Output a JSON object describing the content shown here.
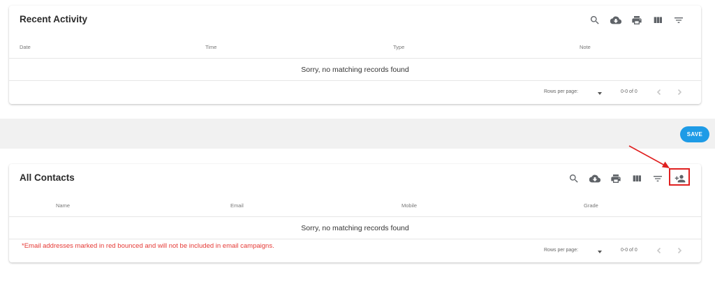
{
  "recent_activity": {
    "title": "Recent Activity",
    "toolbar_icons": [
      "search-icon",
      "cloud-download-icon",
      "print-icon",
      "view-columns-icon",
      "filter-list-icon"
    ],
    "columns": [
      "Date",
      "Time",
      "Type",
      "Note"
    ],
    "empty_message": "Sorry, no matching records found",
    "pagination": {
      "rows_per_page_label": "Rows per page:",
      "range": "0-0 of 0"
    }
  },
  "save_button": {
    "label": "SAVE",
    "color": "#1e9be6"
  },
  "all_contacts": {
    "title": "All Contacts",
    "toolbar_icons": [
      "search-icon",
      "cloud-download-icon",
      "print-icon",
      "view-columns-icon",
      "filter-list-icon",
      "person-add-icon"
    ],
    "columns": [
      "Name",
      "Email",
      "Mobile",
      "Grade"
    ],
    "empty_message": "Sorry, no matching records found",
    "footnote": "*Email addresses marked in red bounced and will not be included in email campaigns.",
    "footnote_color": "#e53935",
    "pagination": {
      "rows_per_page_label": "Rows per page:",
      "range": "0-0 of 0"
    }
  },
  "annotation": {
    "color": "#e02020",
    "target_icon": "person-add-icon"
  }
}
